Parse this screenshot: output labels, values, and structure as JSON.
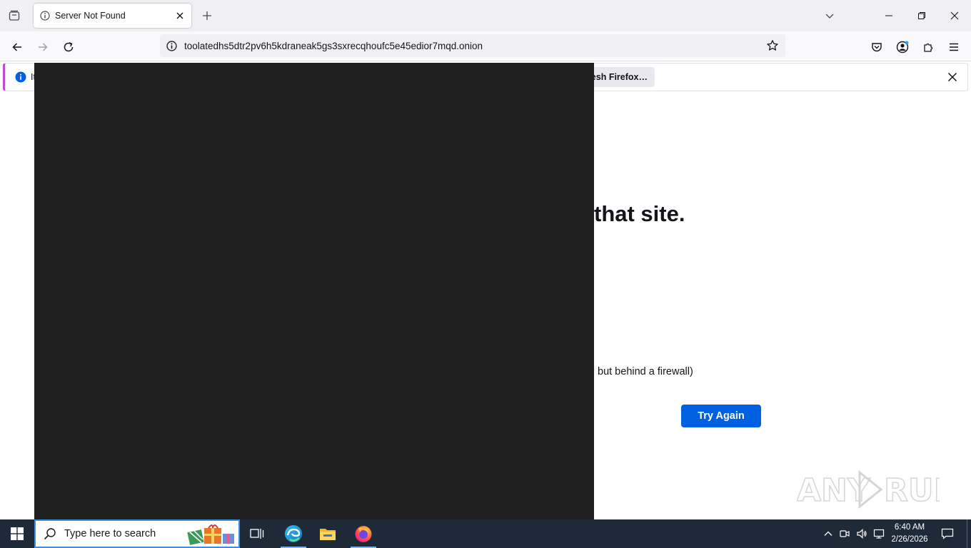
{
  "browser": {
    "tab": {
      "title": "Server Not Found",
      "icon": "info-circle-icon"
    },
    "url": "toolatedhs5dtr2pv6h5kdraneak5gs3sxrecqhoufc5e45edior7mqd.onion",
    "notification": {
      "text_visible": "It",
      "button_label": "Refresh Firefox…"
    }
  },
  "error_page": {
    "title_fragment": "that site.",
    "list_item_fragment": "but behind a firewall)",
    "button_label": "Try Again"
  },
  "watermark": {
    "text": "ANY RUN"
  },
  "taskbar": {
    "search_placeholder": "Type here to search",
    "apps": [
      "task-view",
      "edge",
      "file-explorer",
      "firefox"
    ],
    "clock": {
      "time": "6:40 AM",
      "date": "2/26/2026"
    }
  },
  "colors": {
    "accent": "#0061e0",
    "overlay": "#1f1f1f",
    "taskbar": "#1f2a38",
    "notification_stripe": "#c04cd4"
  }
}
